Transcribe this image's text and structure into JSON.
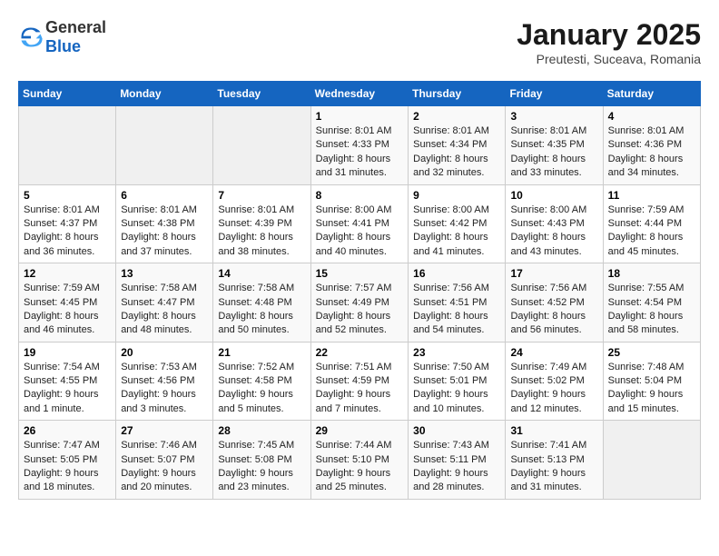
{
  "header": {
    "logo_general": "General",
    "logo_blue": "Blue",
    "title": "January 2025",
    "subtitle": "Preutesti, Suceava, Romania"
  },
  "weekdays": [
    "Sunday",
    "Monday",
    "Tuesday",
    "Wednesday",
    "Thursday",
    "Friday",
    "Saturday"
  ],
  "weeks": [
    [
      {
        "day": "",
        "info": ""
      },
      {
        "day": "",
        "info": ""
      },
      {
        "day": "",
        "info": ""
      },
      {
        "day": "1",
        "info": "Sunrise: 8:01 AM\nSunset: 4:33 PM\nDaylight: 8 hours and 31 minutes."
      },
      {
        "day": "2",
        "info": "Sunrise: 8:01 AM\nSunset: 4:34 PM\nDaylight: 8 hours and 32 minutes."
      },
      {
        "day": "3",
        "info": "Sunrise: 8:01 AM\nSunset: 4:35 PM\nDaylight: 8 hours and 33 minutes."
      },
      {
        "day": "4",
        "info": "Sunrise: 8:01 AM\nSunset: 4:36 PM\nDaylight: 8 hours and 34 minutes."
      }
    ],
    [
      {
        "day": "5",
        "info": "Sunrise: 8:01 AM\nSunset: 4:37 PM\nDaylight: 8 hours and 36 minutes."
      },
      {
        "day": "6",
        "info": "Sunrise: 8:01 AM\nSunset: 4:38 PM\nDaylight: 8 hours and 37 minutes."
      },
      {
        "day": "7",
        "info": "Sunrise: 8:01 AM\nSunset: 4:39 PM\nDaylight: 8 hours and 38 minutes."
      },
      {
        "day": "8",
        "info": "Sunrise: 8:00 AM\nSunset: 4:41 PM\nDaylight: 8 hours and 40 minutes."
      },
      {
        "day": "9",
        "info": "Sunrise: 8:00 AM\nSunset: 4:42 PM\nDaylight: 8 hours and 41 minutes."
      },
      {
        "day": "10",
        "info": "Sunrise: 8:00 AM\nSunset: 4:43 PM\nDaylight: 8 hours and 43 minutes."
      },
      {
        "day": "11",
        "info": "Sunrise: 7:59 AM\nSunset: 4:44 PM\nDaylight: 8 hours and 45 minutes."
      }
    ],
    [
      {
        "day": "12",
        "info": "Sunrise: 7:59 AM\nSunset: 4:45 PM\nDaylight: 8 hours and 46 minutes."
      },
      {
        "day": "13",
        "info": "Sunrise: 7:58 AM\nSunset: 4:47 PM\nDaylight: 8 hours and 48 minutes."
      },
      {
        "day": "14",
        "info": "Sunrise: 7:58 AM\nSunset: 4:48 PM\nDaylight: 8 hours and 50 minutes."
      },
      {
        "day": "15",
        "info": "Sunrise: 7:57 AM\nSunset: 4:49 PM\nDaylight: 8 hours and 52 minutes."
      },
      {
        "day": "16",
        "info": "Sunrise: 7:56 AM\nSunset: 4:51 PM\nDaylight: 8 hours and 54 minutes."
      },
      {
        "day": "17",
        "info": "Sunrise: 7:56 AM\nSunset: 4:52 PM\nDaylight: 8 hours and 56 minutes."
      },
      {
        "day": "18",
        "info": "Sunrise: 7:55 AM\nSunset: 4:54 PM\nDaylight: 8 hours and 58 minutes."
      }
    ],
    [
      {
        "day": "19",
        "info": "Sunrise: 7:54 AM\nSunset: 4:55 PM\nDaylight: 9 hours and 1 minute."
      },
      {
        "day": "20",
        "info": "Sunrise: 7:53 AM\nSunset: 4:56 PM\nDaylight: 9 hours and 3 minutes."
      },
      {
        "day": "21",
        "info": "Sunrise: 7:52 AM\nSunset: 4:58 PM\nDaylight: 9 hours and 5 minutes."
      },
      {
        "day": "22",
        "info": "Sunrise: 7:51 AM\nSunset: 4:59 PM\nDaylight: 9 hours and 7 minutes."
      },
      {
        "day": "23",
        "info": "Sunrise: 7:50 AM\nSunset: 5:01 PM\nDaylight: 9 hours and 10 minutes."
      },
      {
        "day": "24",
        "info": "Sunrise: 7:49 AM\nSunset: 5:02 PM\nDaylight: 9 hours and 12 minutes."
      },
      {
        "day": "25",
        "info": "Sunrise: 7:48 AM\nSunset: 5:04 PM\nDaylight: 9 hours and 15 minutes."
      }
    ],
    [
      {
        "day": "26",
        "info": "Sunrise: 7:47 AM\nSunset: 5:05 PM\nDaylight: 9 hours and 18 minutes."
      },
      {
        "day": "27",
        "info": "Sunrise: 7:46 AM\nSunset: 5:07 PM\nDaylight: 9 hours and 20 minutes."
      },
      {
        "day": "28",
        "info": "Sunrise: 7:45 AM\nSunset: 5:08 PM\nDaylight: 9 hours and 23 minutes."
      },
      {
        "day": "29",
        "info": "Sunrise: 7:44 AM\nSunset: 5:10 PM\nDaylight: 9 hours and 25 minutes."
      },
      {
        "day": "30",
        "info": "Sunrise: 7:43 AM\nSunset: 5:11 PM\nDaylight: 9 hours and 28 minutes."
      },
      {
        "day": "31",
        "info": "Sunrise: 7:41 AM\nSunset: 5:13 PM\nDaylight: 9 hours and 31 minutes."
      },
      {
        "day": "",
        "info": ""
      }
    ]
  ]
}
